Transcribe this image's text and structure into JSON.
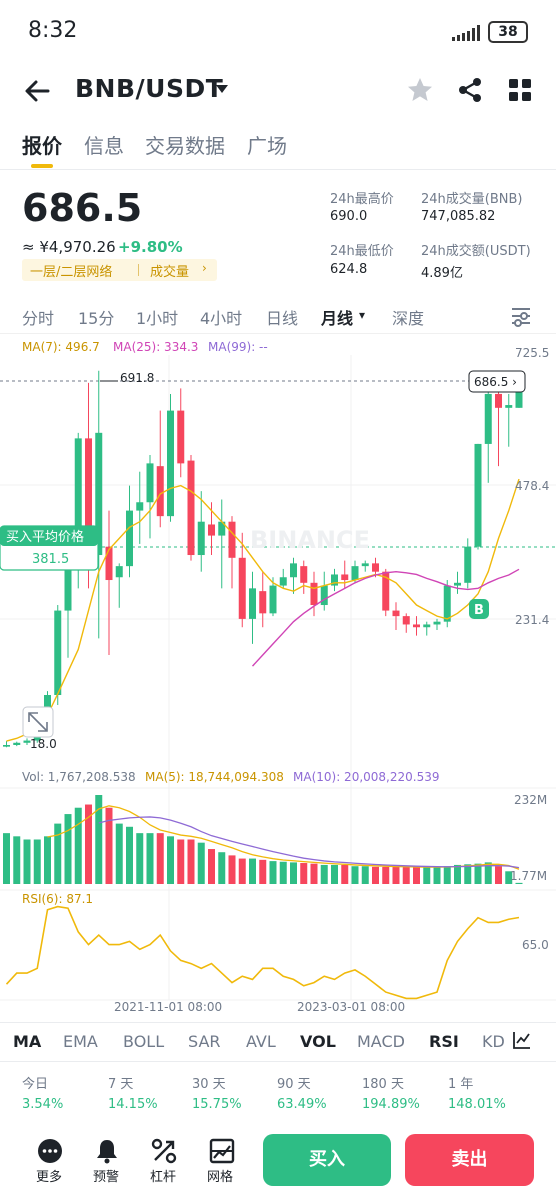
{
  "status": {
    "time": "8:32",
    "battery": "38"
  },
  "header": {
    "pair": "BNB/USDT"
  },
  "tabs": [
    "报价",
    "信息",
    "交易数据",
    "广场"
  ],
  "price": {
    "last": "686.5",
    "cny": "≈ ¥4,970.26",
    "change": "+9.80%",
    "promo_a": "一层/二层网络",
    "promo_b": "成交量",
    "promo_arrow": "›"
  },
  "stats": {
    "high_label": "24h最高价",
    "high": "690.0",
    "low_label": "24h最低价",
    "low": "624.8",
    "vol_label": "24h成交量(BNB)",
    "vol": "747,085.82",
    "amt_label": "24h成交额(USDT)",
    "amt": "4.89亿"
  },
  "intervals": [
    "分时",
    "15分",
    "1小时",
    "4小时",
    "日线",
    "月线",
    "深度"
  ],
  "active_interval_caret": "▾",
  "ma_legend": {
    "ma7": "MA(7): 496.7",
    "ma25": "MA(25): 334.3",
    "ma99": "MA(99): --"
  },
  "chart_labels": {
    "axis_top": "725.5",
    "axis_mid": "478.4",
    "axis_low": "231.4",
    "max_label": "691.8",
    "min_label": "18.0",
    "current": "686.5 ›",
    "avg_title": "买入平均价格",
    "avg_value": "381.5",
    "buy_marker": "B",
    "watermark": "BINANCE",
    "vol_legend": "Vol: 1,767,208.538",
    "vol_ma5": "MA(5): 18,744,094.308",
    "vol_ma10": "MA(10): 20,008,220.539",
    "vol_axis_top": "232M",
    "vol_axis_bot": "1.77M",
    "rsi_legend": "RSI(6): 87.1",
    "rsi_axis": "65.0",
    "date_1": "2021-11-01 08:00",
    "date_2": "2023-03-01 08:00"
  },
  "colors": {
    "up": "#2ebd85",
    "down": "#f6465d",
    "ma7": "#f0b90b",
    "ma25": "#d045b6",
    "ma99": "#8e6ad5",
    "accent": "#f0b90b"
  },
  "indicators": [
    "MA",
    "EMA",
    "BOLL",
    "SAR",
    "AVL",
    "VOL",
    "MACD",
    "RSI",
    "KD"
  ],
  "performance": [
    {
      "label": "今日",
      "value": "3.54%"
    },
    {
      "label": "7 天",
      "value": "14.15%"
    },
    {
      "label": "30 天",
      "value": "15.75%"
    },
    {
      "label": "90 天",
      "value": "63.49%"
    },
    {
      "label": "180 天",
      "value": "194.89%"
    },
    {
      "label": "1 年",
      "value": "148.01%"
    }
  ],
  "bottom_nav": [
    {
      "label": "更多",
      "icon": "more-icon"
    },
    {
      "label": "预警",
      "icon": "bell-icon"
    },
    {
      "label": "杠杆",
      "icon": "margin-icon"
    },
    {
      "label": "网格",
      "icon": "grid-bot-icon"
    }
  ],
  "actions": {
    "buy": "买入",
    "sell": "卖出"
  },
  "chart_data": {
    "type": "candlestick",
    "interval": "月线",
    "candles": [
      {
        "o": 15,
        "h": 25,
        "l": 14,
        "c": 18
      },
      {
        "o": 18,
        "h": 24,
        "l": 16,
        "c": 22
      },
      {
        "o": 22,
        "h": 30,
        "l": 18,
        "c": 26
      },
      {
        "o": 26,
        "h": 40,
        "l": 22,
        "c": 38
      },
      {
        "o": 38,
        "h": 115,
        "l": 34,
        "c": 108
      },
      {
        "o": 108,
        "h": 270,
        "l": 90,
        "c": 260
      },
      {
        "o": 260,
        "h": 350,
        "l": 175,
        "c": 340
      },
      {
        "o": 340,
        "h": 580,
        "l": 300,
        "c": 570
      },
      {
        "o": 570,
        "h": 670,
        "l": 300,
        "c": 360
      },
      {
        "o": 360,
        "h": 691.8,
        "l": 210,
        "c": 580
      },
      {
        "o": 375,
        "h": 440,
        "l": 180,
        "c": 315
      },
      {
        "o": 320,
        "h": 345,
        "l": 265,
        "c": 340
      },
      {
        "o": 340,
        "h": 485,
        "l": 320,
        "c": 440
      },
      {
        "o": 440,
        "h": 510,
        "l": 380,
        "c": 455
      },
      {
        "o": 455,
        "h": 540,
        "l": 390,
        "c": 525
      },
      {
        "o": 520,
        "h": 620,
        "l": 410,
        "c": 430
      },
      {
        "o": 430,
        "h": 650,
        "l": 420,
        "c": 620
      },
      {
        "o": 620,
        "h": 660,
        "l": 500,
        "c": 525
      },
      {
        "o": 530,
        "h": 540,
        "l": 350,
        "c": 360
      },
      {
        "o": 360,
        "h": 475,
        "l": 330,
        "c": 420
      },
      {
        "o": 415,
        "h": 455,
        "l": 360,
        "c": 395
      },
      {
        "o": 395,
        "h": 460,
        "l": 300,
        "c": 420
      },
      {
        "o": 420,
        "h": 430,
        "l": 300,
        "c": 355
      },
      {
        "o": 355,
        "h": 400,
        "l": 230,
        "c": 245
      },
      {
        "o": 245,
        "h": 330,
        "l": 200,
        "c": 300
      },
      {
        "o": 295,
        "h": 330,
        "l": 230,
        "c": 255
      },
      {
        "o": 255,
        "h": 320,
        "l": 250,
        "c": 305
      },
      {
        "o": 305,
        "h": 335,
        "l": 300,
        "c": 320
      },
      {
        "o": 320,
        "h": 355,
        "l": 290,
        "c": 345
      },
      {
        "o": 340,
        "h": 350,
        "l": 290,
        "c": 310
      },
      {
        "o": 310,
        "h": 330,
        "l": 250,
        "c": 270
      },
      {
        "o": 270,
        "h": 330,
        "l": 260,
        "c": 305
      },
      {
        "o": 305,
        "h": 335,
        "l": 295,
        "c": 325
      },
      {
        "o": 325,
        "h": 350,
        "l": 300,
        "c": 315
      },
      {
        "o": 315,
        "h": 350,
        "l": 310,
        "c": 340
      },
      {
        "o": 340,
        "h": 350,
        "l": 330,
        "c": 345
      },
      {
        "o": 345,
        "h": 355,
        "l": 320,
        "c": 330
      },
      {
        "o": 330,
        "h": 335,
        "l": 250,
        "c": 260
      },
      {
        "o": 260,
        "h": 275,
        "l": 225,
        "c": 250
      },
      {
        "o": 250,
        "h": 255,
        "l": 220,
        "c": 235
      },
      {
        "o": 235,
        "h": 250,
        "l": 215,
        "c": 230
      },
      {
        "o": 230,
        "h": 240,
        "l": 215,
        "c": 235
      },
      {
        "o": 235,
        "h": 245,
        "l": 225,
        "c": 240
      },
      {
        "o": 240,
        "h": 315,
        "l": 230,
        "c": 305
      },
      {
        "o": 305,
        "h": 330,
        "l": 290,
        "c": 310
      },
      {
        "o": 310,
        "h": 390,
        "l": 300,
        "c": 375
      },
      {
        "o": 375,
        "h": 560,
        "l": 370,
        "c": 560
      },
      {
        "o": 560,
        "h": 660,
        "l": 490,
        "c": 650
      },
      {
        "o": 650,
        "h": 670,
        "l": 520,
        "c": 625
      },
      {
        "o": 625,
        "h": 650,
        "l": 555,
        "c": 630
      },
      {
        "o": 625,
        "h": 690,
        "l": 624.8,
        "c": 686.5
      }
    ],
    "ma7": [
      25,
      30,
      38,
      52,
      72,
      110,
      150,
      190,
      260,
      330,
      370,
      390,
      410,
      420,
      440,
      470,
      480,
      485,
      475,
      460,
      440,
      420,
      400,
      380,
      355,
      330,
      310,
      300,
      295,
      305,
      300,
      305,
      310,
      310,
      315,
      320,
      325,
      320,
      310,
      290,
      270,
      260,
      250,
      245,
      255,
      270,
      290,
      330,
      390,
      440,
      496.7
    ],
    "ma25": [
      null,
      null,
      null,
      null,
      null,
      null,
      null,
      null,
      null,
      null,
      null,
      null,
      null,
      null,
      null,
      null,
      null,
      null,
      null,
      null,
      null,
      null,
      null,
      null,
      160,
      180,
      200,
      220,
      240,
      255,
      268,
      280,
      290,
      300,
      310,
      318,
      324,
      328,
      330,
      328,
      325,
      318,
      312,
      305,
      300,
      298,
      300,
      310,
      318,
      324,
      334.3
    ],
    "volume": [
      80,
      75,
      70,
      70,
      75,
      95,
      110,
      120,
      125,
      140,
      120,
      95,
      90,
      80,
      80,
      80,
      75,
      70,
      70,
      65,
      55,
      50,
      45,
      40,
      40,
      38,
      36,
      35,
      34,
      33,
      32,
      30,
      30,
      30,
      28,
      28,
      27,
      27,
      27,
      27,
      26,
      26,
      27,
      28,
      30,
      31,
      32,
      34,
      28,
      20,
      1.77
    ],
    "rsi6": [
      45,
      52,
      52,
      55,
      92,
      94,
      93,
      78,
      70,
      76,
      70,
      70,
      72,
      67,
      70,
      76,
      66,
      60,
      58,
      55,
      58,
      52,
      46,
      50,
      48,
      55,
      55,
      50,
      48,
      44,
      46,
      50,
      48,
      52,
      54,
      50,
      45,
      40,
      38,
      36,
      36,
      38,
      40,
      60,
      72,
      80,
      87,
      84,
      84,
      86,
      87.1
    ]
  }
}
